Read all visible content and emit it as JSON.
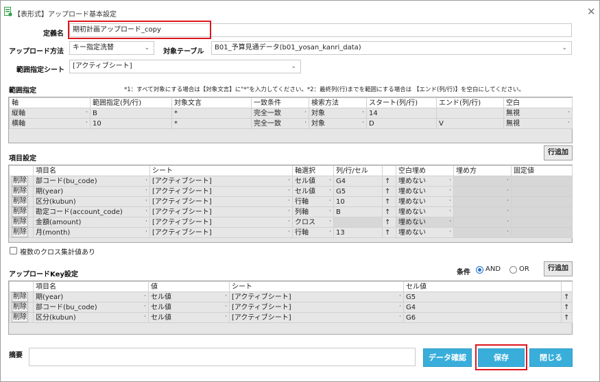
{
  "window": {
    "title": "【表形式】アップロード基本設定",
    "close_glyph": "✕"
  },
  "definition": {
    "label": "定義名",
    "value": "期初計画アップロード_copy"
  },
  "upload_method": {
    "label": "アップロード方法",
    "value": "キー指定洗替"
  },
  "target_table": {
    "label": "対象テーブル",
    "value": "B01_予算見通データ(b01_yosan_kanri_data)"
  },
  "range_sheet": {
    "label": "範囲指定シート",
    "value": "[アクティブシート]"
  },
  "range": {
    "heading": "範囲指定",
    "note": "*1：すべて対象にする場合は【対象文言】に\"*\"を入力してください。*2：最終列(行)までを範囲にする場合は 【エンド(列/行)】を空白にしてください。",
    "headers": [
      "軸",
      "範囲指定(列/行)",
      "対象文言",
      "一致条件",
      "検索方法",
      "スタート(列/行)",
      "エンド(列/行)",
      "空白"
    ],
    "rows": [
      [
        "縦軸",
        "B",
        "*",
        "完全一致",
        "対象",
        "14",
        "",
        "無視"
      ],
      [
        "横軸",
        "10",
        "*",
        "完全一致",
        "対象",
        "D",
        "V",
        "無視"
      ]
    ]
  },
  "items": {
    "heading": "項目設定",
    "add_row": "行追加",
    "headers": [
      "項目名",
      "シート",
      "軸選択",
      "列/行/セル",
      "空白埋め",
      "埋め方",
      "固定値"
    ],
    "delete_label": "削除",
    "up_arrow": "↑",
    "rows": [
      [
        "部コード(bu_code)",
        "[アクティブシート]",
        "セル値",
        "G4",
        "埋めない",
        "",
        ""
      ],
      [
        "期(year)",
        "[アクティブシート]",
        "セル値",
        "G5",
        "埋めない",
        "",
        ""
      ],
      [
        "区分(kubun)",
        "[アクティブシート]",
        "行軸",
        "10",
        "埋めない",
        "",
        ""
      ],
      [
        "勘定コード(account_code)",
        "[アクティブシート]",
        "列軸",
        "B",
        "埋めない",
        "",
        ""
      ],
      [
        "金額(amount)",
        "[アクティブシート]",
        "クロス",
        "",
        "埋めない",
        "",
        ""
      ],
      [
        "月(month)",
        "[アクティブシート]",
        "行軸",
        "13",
        "埋めない",
        "",
        ""
      ]
    ],
    "multi_cross_label": "複数のクロス集計値あり"
  },
  "key": {
    "heading": "アップロードKey設定",
    "condition_label": "条件",
    "and_label": "AND",
    "or_label": "OR",
    "add_row": "行追加",
    "headers": [
      "項目名",
      "値",
      "シート",
      "セル値"
    ],
    "rows": [
      [
        "期(year)",
        "セル値",
        "[アクティブシート]",
        "G5"
      ],
      [
        "部コード(bu_code)",
        "セル値",
        "[アクティブシート]",
        "G4"
      ],
      [
        "区分(kubun)",
        "セル値",
        "[アクティブシート]",
        "G6"
      ]
    ]
  },
  "summary": {
    "label": "摘要",
    "value": ""
  },
  "buttons": {
    "confirm": "データ確認",
    "save": "保存",
    "close": "閉じる"
  },
  "colors": {
    "accent": "#3aaedb",
    "highlight": "#e0141e"
  }
}
